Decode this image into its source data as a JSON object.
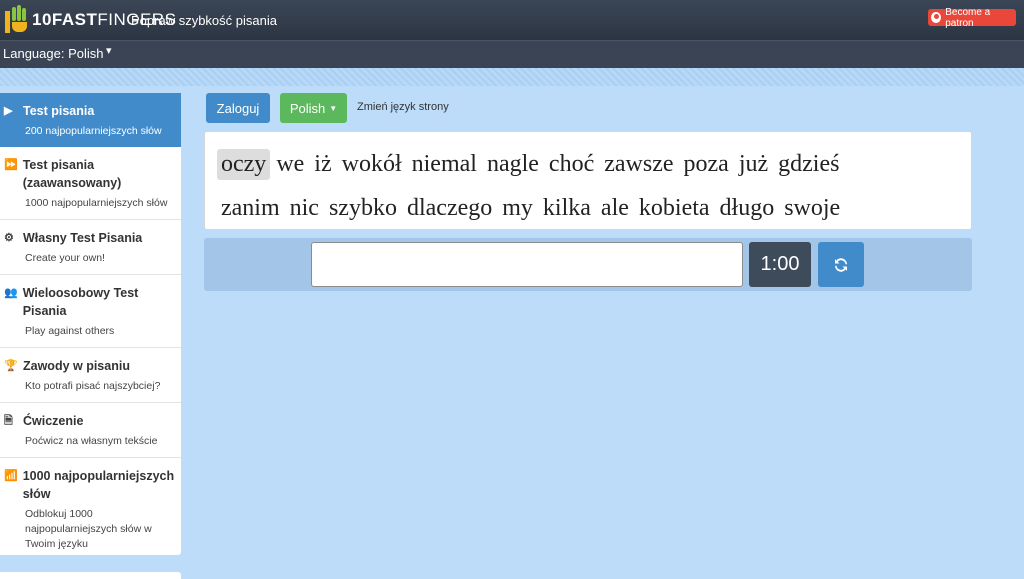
{
  "header": {
    "logo_bold": "10FAST",
    "logo_light": "FINGERS",
    "tagline": "Popraw szybkość pisania",
    "patron_label": "Become a patron"
  },
  "language_bar": {
    "label": "Language: Polish",
    "chevron": "▾"
  },
  "sidebar": {
    "items": [
      {
        "icon": "play-icon",
        "title": "Test pisania",
        "subtitle": "200 najpopularniejszych słów"
      },
      {
        "icon": "fast-forward-icon",
        "title": "Test pisania (zaawansowany)",
        "subtitle": "1000 najpopularniejszych słów"
      },
      {
        "icon": "gears-icon",
        "title": "Własny Test Pisania",
        "subtitle": "Create your own!"
      },
      {
        "icon": "users-icon",
        "title": "Wieloosobowy Test Pisania",
        "subtitle": "Play against others"
      },
      {
        "icon": "trophy-icon",
        "title": "Zawody w pisaniu",
        "subtitle": "Kto potrafi pisać najszybciej?"
      },
      {
        "icon": "document-icon",
        "title": "Ćwiczenie",
        "subtitle": "Poćwicz na własnym tekście"
      },
      {
        "icon": "signal-icon",
        "title": "1000 najpopularniejszych słów",
        "subtitle": "Odblokuj 1000 najpopularniejszych słów w Twoim języku"
      }
    ]
  },
  "toolbar": {
    "login_label": "Zaloguj",
    "language_label": "Polish",
    "change_language_label": "Zmień język strony"
  },
  "words": {
    "line1": [
      "oczy",
      "we",
      "iż",
      "wokół",
      "niemal",
      "nagle",
      "choć",
      "zawsze",
      "poza",
      "już",
      "gdzieś"
    ],
    "line2": [
      "zanim",
      "nic",
      "szybko",
      "dlaczego",
      "my",
      "kilka",
      "ale",
      "kobieta",
      "długo",
      "swoje"
    ]
  },
  "typing": {
    "input_value": "",
    "timer": "1:00"
  },
  "colors": {
    "accent": "#428bca",
    "green": "#5cb85c",
    "patron": "#e8473a",
    "background": "#bcdcfa"
  }
}
